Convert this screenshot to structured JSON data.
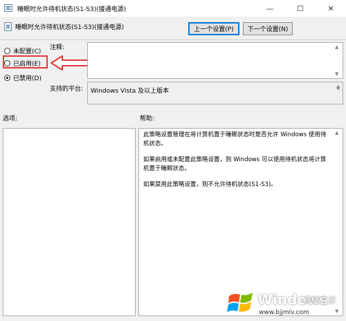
{
  "window": {
    "title": "睡眠时允许待机状态(S1-S3)(接通电源)",
    "minimize": "—",
    "maximize": "☐",
    "close": "✕"
  },
  "header": {
    "policy_name": "睡眠时允许待机状态(S1-S3)(接通电源)",
    "prev_button": "上一个设置(P)",
    "next_button": "下一个设置(N)"
  },
  "options": {
    "not_configured": "未配置(C)",
    "enabled": "已启用(E)",
    "disabled": "已禁用(D)",
    "selected": "disabled"
  },
  "comment": {
    "label": "注释:",
    "value": ""
  },
  "supported": {
    "label": "支持的平台:",
    "value": "Windows Vista 及以上版本"
  },
  "sections": {
    "options_label": "选项:",
    "help_label": "帮助:"
  },
  "help": {
    "p1": "此策略设置管理在将计算机置于睡眠状态时是否允许 Windows 使用待机状态。",
    "p2": "如果启用或未配置此策略设置，则 Windows 可以使用待机状态将计算机置于睡眠状态。",
    "p3": "如果禁用此策略设置，则不允许待机状态(S1-S3)。"
  },
  "annotation": {
    "highlight_color": "#e53935"
  },
  "watermark": {
    "brand": "Windows",
    "cn": "系统之家",
    "url": "www.bjjmlv.com"
  }
}
